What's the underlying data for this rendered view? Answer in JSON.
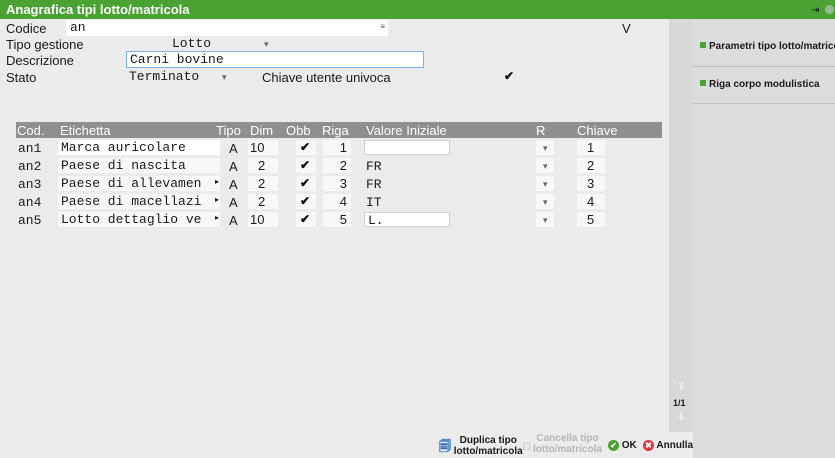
{
  "window": {
    "title": "Anagrafica tipi lotto/matricola"
  },
  "form": {
    "codice_label": "Codice",
    "codice_value": "an",
    "codice_suffix": "V",
    "tipo_gestione_label": "Tipo gestione",
    "tipo_gestione_value": "Lotto",
    "descrizione_label": "Descrizione",
    "descrizione_value": "Carni bovine",
    "stato_label": "Stato",
    "stato_value": "Terminato",
    "chiave_label": "Chiave utente univoca"
  },
  "grid": {
    "columns": [
      "Cod.",
      "Etichetta",
      "Tipo",
      "Dim",
      "Obb",
      "Riga",
      "Valore Iniziale",
      "R",
      "Chiave"
    ],
    "rows": [
      {
        "cod": "an1",
        "etichetta": "Marca auricolare",
        "tipo": "A",
        "dim": "10",
        "riga": "1",
        "valore": "",
        "chiave": "1"
      },
      {
        "cod": "an2",
        "etichetta": "Paese di nascita",
        "tipo": "A",
        "dim": "2",
        "riga": "2",
        "valore": "FR",
        "chiave": "2"
      },
      {
        "cod": "an3",
        "etichetta": "Paese di allevamen",
        "tipo": "A",
        "dim": "2",
        "riga": "3",
        "valore": "FR",
        "chiave": "3"
      },
      {
        "cod": "an4",
        "etichetta": "Paese di macellazi",
        "tipo": "A",
        "dim": "2",
        "riga": "4",
        "valore": "IT",
        "chiave": "4"
      },
      {
        "cod": "an5",
        "etichetta": "Lotto dettaglio ve",
        "tipo": "A",
        "dim": "10",
        "riga": "5",
        "valore": "L.",
        "chiave": "5"
      }
    ],
    "page_indicator": "1/1"
  },
  "sidebar": {
    "btn1": "Parametri tipo lotto/matricola",
    "btn2": "Riga corpo modulistica"
  },
  "footer": {
    "duplica_line1": "Duplica tipo",
    "duplica_line2": "lotto/matricola",
    "cancella_line1": "Cancella tipo",
    "cancella_line2": "lotto/matricola",
    "ok": "OK",
    "annulla": "Annulla"
  },
  "colors": {
    "titlebar": "#4aa232",
    "panel": "#ebebeb",
    "grid_header": "#8f8f8f",
    "focus_border": "#7fb0e6"
  }
}
